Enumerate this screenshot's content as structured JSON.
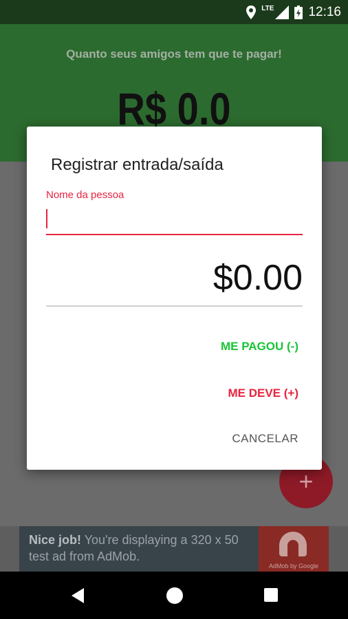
{
  "status_bar": {
    "network": "LTE",
    "time": "12:16"
  },
  "header": {
    "subtitle": "Quanto seus amigos tem que te pagar!",
    "balance": "R$ 0.0"
  },
  "fab": {
    "icon": "plus-icon",
    "label": "+"
  },
  "ad": {
    "headline": "Nice job!",
    "body": " You're displaying a 320 x 50 test ad from AdMob.",
    "logo_caption": "AdMob by Google"
  },
  "dialog": {
    "title": "Registrar entrada/saída",
    "name_label": "Nome da pessoa",
    "name_value": "",
    "amount": "$0.00",
    "actions": {
      "paid": "ME PAGOU (-)",
      "owes": "ME DEVE (+)",
      "cancel": "CANCELAR"
    }
  },
  "colors": {
    "header_green": "#2c6b2f",
    "accent_red": "#e8233d",
    "paid_green": "#17c534"
  }
}
